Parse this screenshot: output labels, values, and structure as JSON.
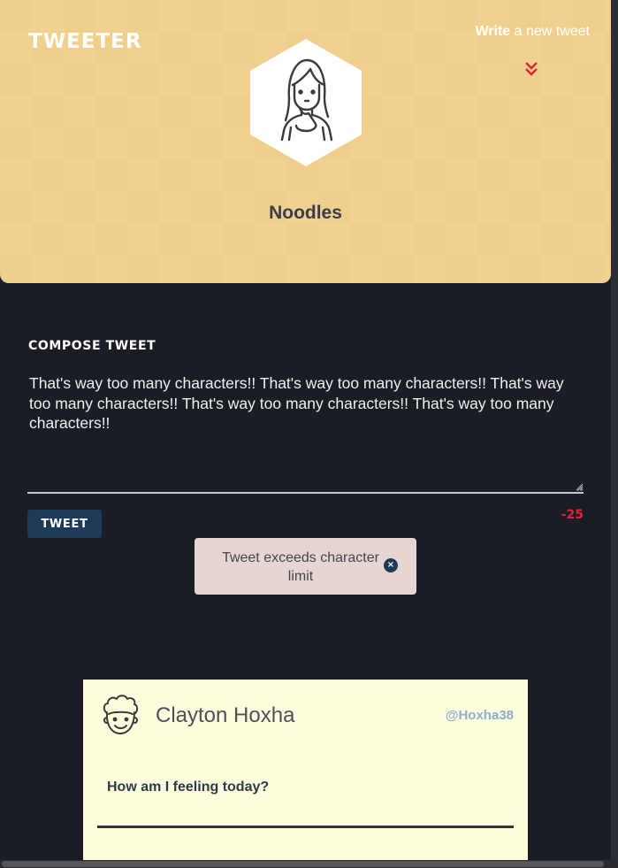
{
  "header": {
    "logo": "TWEETER",
    "nav_write_bold": "Write",
    "nav_write_rest": " a new tweet",
    "profile_name": "Noodles"
  },
  "compose": {
    "title": "COMPOSE TWEET",
    "text": "That's way too many characters!! That's way too many characters!! That's way too many characters!! That's way too many characters!! That's way too many characters!!",
    "button_label": "TWEET",
    "counter": "-25",
    "error_message": "Tweet exceeds character limit",
    "error_close": "×"
  },
  "tweet": {
    "name": "Clayton Hoxha",
    "handle": "@Hoxha38",
    "text": "How am I feeling today?"
  },
  "colors": {
    "header_bg": "#efcf8c",
    "page_bg": "#1b1d24",
    "accent": "#1d3a58",
    "error": "#e0233a",
    "card_bg": "#fdfdde",
    "handle": "#8bb0c9"
  }
}
